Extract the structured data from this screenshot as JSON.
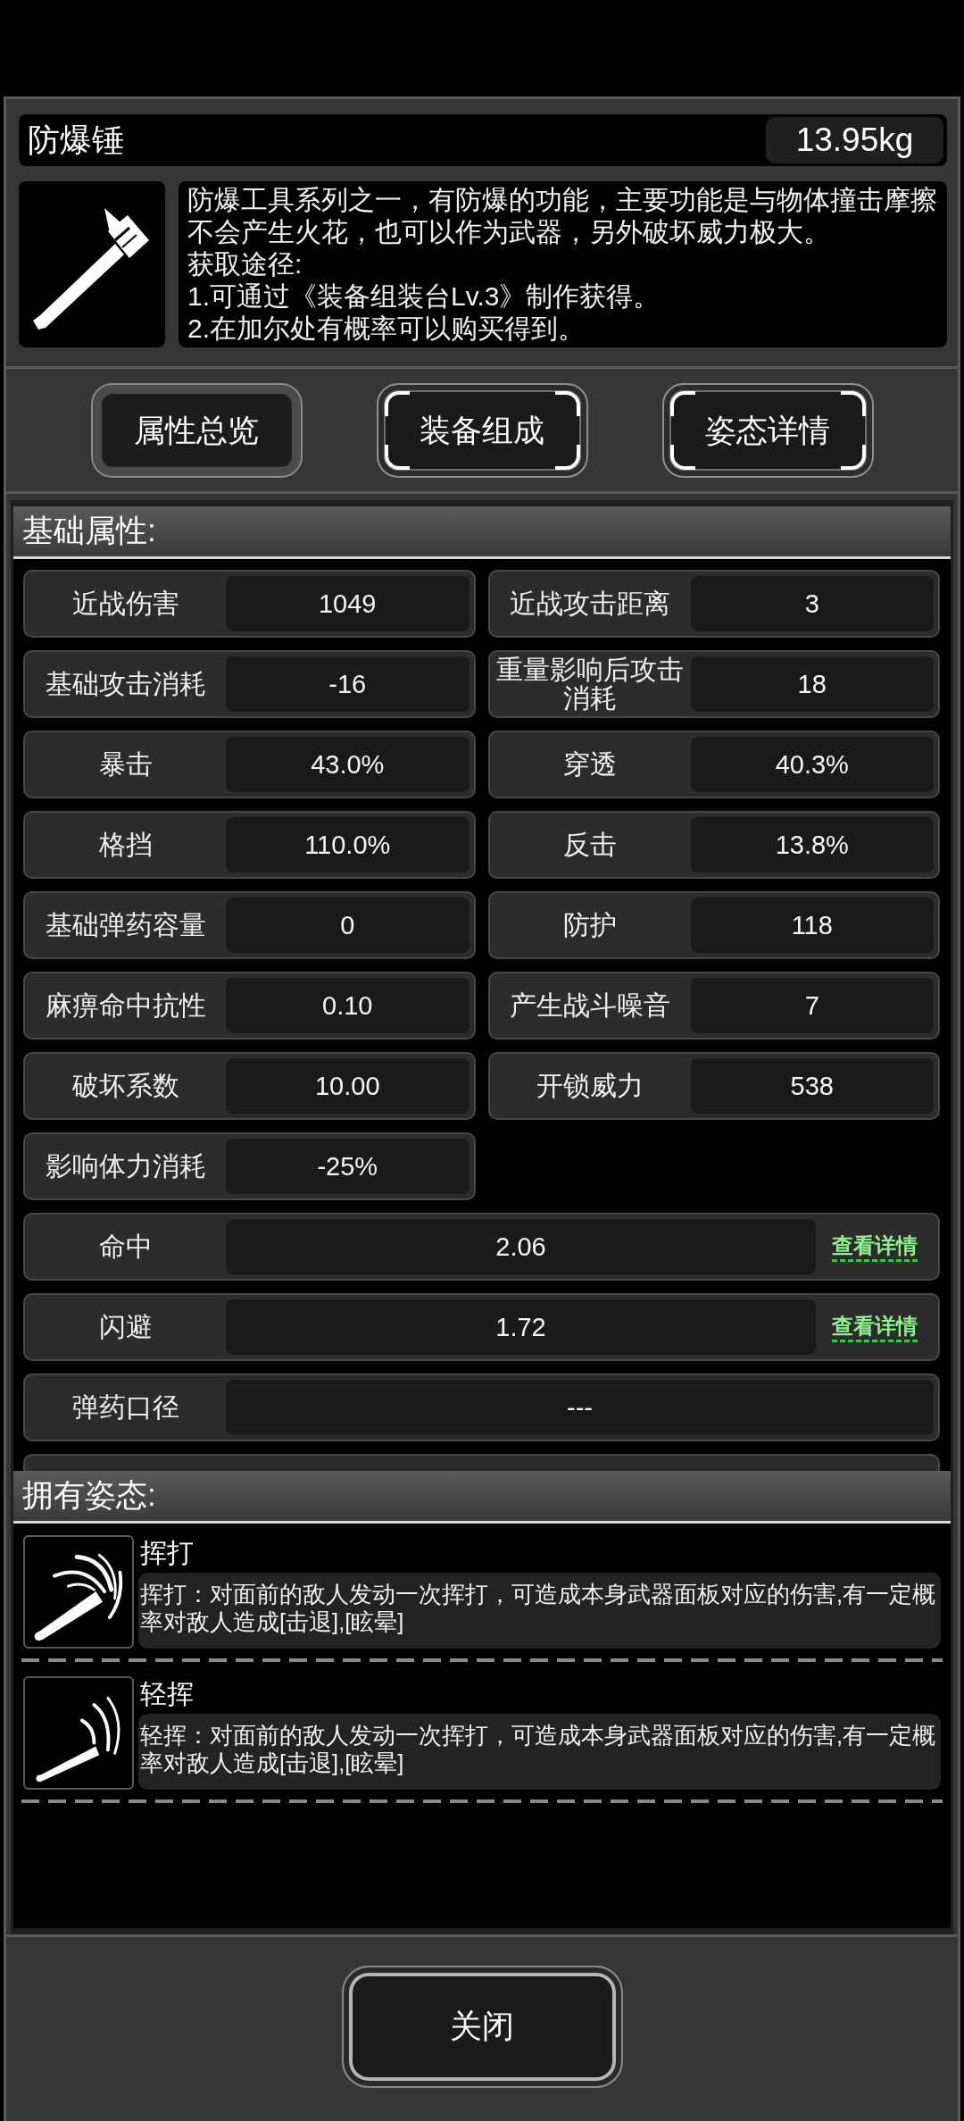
{
  "item": {
    "name": "防爆锤",
    "weight": "13.95kg",
    "description": "防爆工具系列之一，有防爆的功能，主要功能是与物体撞击摩擦不会产生火花，也可以作为武器，另外破坏威力极大。",
    "acquisition_heading": "获取途径:",
    "acquisition_methods": [
      "1.可通过《装备组装台Lv.3》制作获得。",
      "2.在加尔处有概率可以购买得到。"
    ]
  },
  "tabs": [
    {
      "label": "属性总览",
      "selected": true
    },
    {
      "label": "装备组成",
      "selected": false
    },
    {
      "label": "姿态详情",
      "selected": false
    }
  ],
  "basic_attributes": {
    "title": "基础属性:",
    "stats": [
      {
        "kind": "half",
        "label": "近战伤害",
        "value": "1049"
      },
      {
        "kind": "half",
        "label": "近战攻击距离",
        "value": "3"
      },
      {
        "kind": "half",
        "label": "基础攻击消耗",
        "value": "-16"
      },
      {
        "kind": "half",
        "label": "重量影响后攻击消耗",
        "value": "18"
      },
      {
        "kind": "half",
        "label": "暴击",
        "value": "43.0%"
      },
      {
        "kind": "half",
        "label": "穿透",
        "value": "40.3%"
      },
      {
        "kind": "half",
        "label": "格挡",
        "value": "110.0%"
      },
      {
        "kind": "half",
        "label": "反击",
        "value": "13.8%"
      },
      {
        "kind": "half",
        "label": "基础弹药容量",
        "value": "0"
      },
      {
        "kind": "half",
        "label": "防护",
        "value": "118"
      },
      {
        "kind": "half",
        "label": "麻痹命中抗性",
        "value": "0.10"
      },
      {
        "kind": "half",
        "label": "产生战斗噪音",
        "value": "7"
      },
      {
        "kind": "half",
        "label": "破坏系数",
        "value": "10.00"
      },
      {
        "kind": "half",
        "label": "开锁威力",
        "value": "538"
      },
      {
        "kind": "half",
        "label": "影响体力消耗",
        "value": "-25%"
      },
      {
        "kind": "wide",
        "label": "命中",
        "value": "2.06",
        "link": "查看详情"
      },
      {
        "kind": "wide",
        "label": "闪避",
        "value": "1.72",
        "link": "查看详情"
      },
      {
        "kind": "wide",
        "label": "弹药口径",
        "value": "---"
      }
    ],
    "clipped_row_below": true
  },
  "postures": {
    "title": "拥有姿态:",
    "items": [
      {
        "kind": "swing",
        "name": "挥打",
        "description": "挥打：对面前的敌人发动一次挥打，可造成本身武器面板对应的伤害,有一定概率对敌人造成[击退],[眩晕]"
      },
      {
        "kind": "light_swing",
        "name": "轻挥",
        "description": "轻挥：对面前的敌人发动一次挥打，可造成本身武器面板对应的伤害,有一定概率对敌人造成[击退],[眩晕]"
      }
    ]
  },
  "close_button": {
    "label": "关闭"
  }
}
